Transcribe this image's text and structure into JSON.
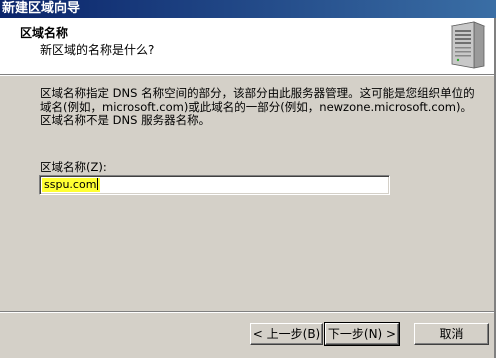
{
  "window": {
    "title": "新建区域向导"
  },
  "header": {
    "title": "区域名称",
    "subtitle": "新区域的名称是什么?",
    "icon": "server-icon"
  },
  "body": {
    "description": "区域名称指定 DNS 名称空间的部分，该部分由此服务器管理。这可能是您组织单位的域名(例如，microsoft.com)或此域名的一部分(例如，newzone.microsoft.com)。区域名称不是 DNS 服务器名称。",
    "zone_name_label": "区域名称(Z):",
    "zone_name_value": "sspu.com",
    "highlight_color": "#ffff33"
  },
  "buttons": {
    "back": "< 上一步(B)",
    "next": "下一步(N) >",
    "cancel": "取消"
  },
  "colors": {
    "titlebar_start": "#0a246a",
    "titlebar_end": "#3a6ea5",
    "dialog_bg": "#d4d0c8"
  }
}
